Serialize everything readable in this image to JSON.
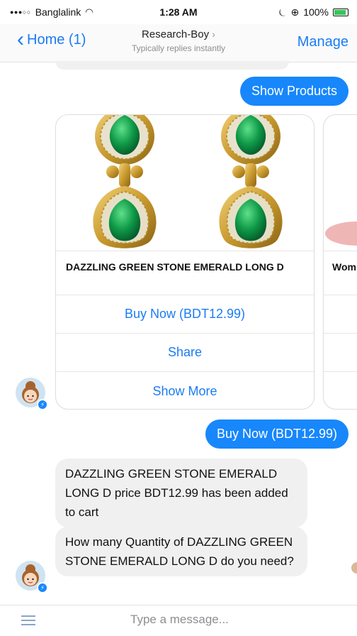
{
  "status_bar": {
    "carrier": "Banglalink",
    "time": "1:28 AM",
    "battery": "100%",
    "battery_level": 1.0
  },
  "nav": {
    "back_label": "Home (1)",
    "title": "Research-Boy",
    "subtitle": "Typically replies instantly",
    "manage_label": "Manage"
  },
  "messages": {
    "show_products": "Show Products",
    "buy_now_sent": "Buy Now (BDT12.99)",
    "added_to_cart": "DAZZLING GREEN STONE EMERALD LONG D price BDT12.99 has been added to cart",
    "quantity_question": "How many Quantity of DAZZLING GREEN STONE EMERALD LONG D do you need?"
  },
  "product_card": {
    "title": "DAZZLING GREEN STONE EMERALD LONG D",
    "buttons": [
      "Buy Now (BDT12.99)",
      "Share",
      "Show More"
    ]
  },
  "product_card_2": {
    "title_partial": "Wom"
  },
  "composer": {
    "placeholder": "Type a message..."
  },
  "colors": {
    "accent": "#1787fb",
    "link": "#1a7cf5",
    "incoming_bubble": "#f0f0f0"
  }
}
